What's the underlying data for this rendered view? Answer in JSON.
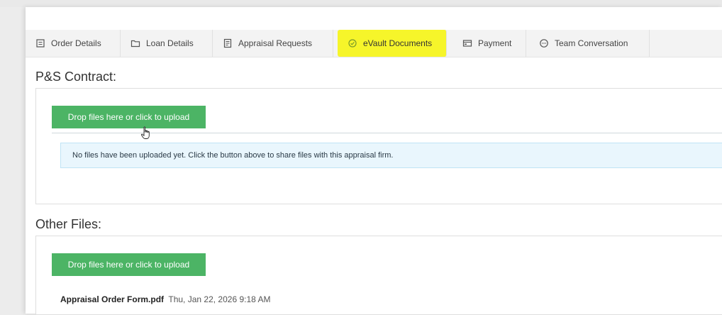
{
  "tabs": [
    {
      "label": "Order Details",
      "icon": "order-icon",
      "active": false
    },
    {
      "label": "Loan Details",
      "icon": "folder-icon",
      "active": false
    },
    {
      "label": "Appraisal Requests",
      "icon": "requests-icon",
      "active": false
    },
    {
      "label": "eVault Documents",
      "icon": "shield-check-icon",
      "active": true
    },
    {
      "label": "Payment",
      "icon": "payment-icon",
      "active": false
    },
    {
      "label": "Team Conversation",
      "icon": "chat-icon",
      "active": false
    }
  ],
  "ps_contract": {
    "title": "P&S Contract:",
    "upload_label": "Drop files here or click to upload",
    "empty_message": "No files have been uploaded yet. Click the button above to share files with this appraisal firm."
  },
  "other_files": {
    "title": "Other Files:",
    "upload_label": "Drop files here or click to upload",
    "files": [
      {
        "name": "Appraisal Order Form.pdf",
        "date": "Thu, Jan 22, 2026 9:18 AM"
      }
    ]
  },
  "colors": {
    "upload_button": "#4cb465",
    "active_tab_highlight": "#f6f52a",
    "info_box": "#e9f6fd"
  }
}
